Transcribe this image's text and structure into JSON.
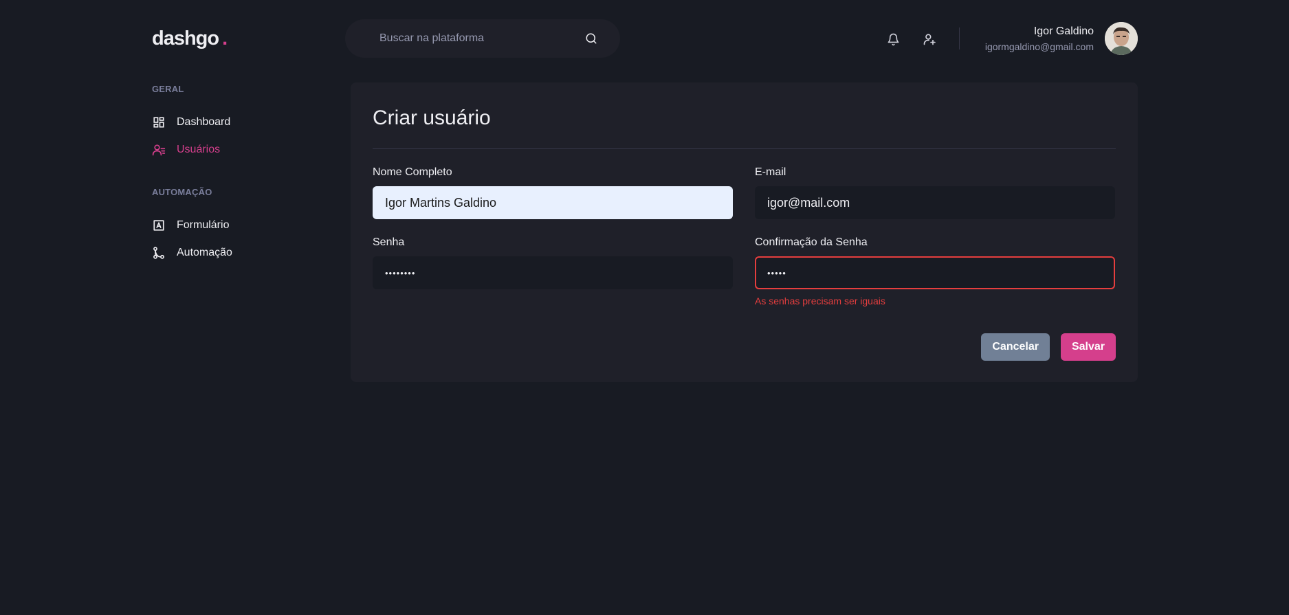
{
  "header": {
    "logo": "dashgo",
    "logo_dot": ".",
    "search_placeholder": "Buscar na plataforma",
    "user_name": "Igor Galdino",
    "user_email": "igormgaldino@gmail.com"
  },
  "sidebar": {
    "sections": [
      {
        "title": "GERAL",
        "items": [
          {
            "label": "Dashboard",
            "icon": "dashboard-icon",
            "active": false
          },
          {
            "label": "Usuários",
            "icon": "users-icon",
            "active": true
          }
        ]
      },
      {
        "title": "AUTOMAÇÃO",
        "items": [
          {
            "label": "Formulário",
            "icon": "form-icon",
            "active": false
          },
          {
            "label": "Automação",
            "icon": "git-merge-icon",
            "active": false
          }
        ]
      }
    ]
  },
  "form": {
    "title": "Criar usuário",
    "fields": {
      "name": {
        "label": "Nome Completo",
        "value": "Igor Martins Galdino"
      },
      "email": {
        "label": "E-mail",
        "value": "igor@mail.com"
      },
      "password": {
        "label": "Senha",
        "value": "••••••••"
      },
      "password_confirmation": {
        "label": "Confirmação da Senha",
        "value": "•••••",
        "error": "As senhas precisam ser iguais"
      }
    },
    "cancel_label": "Cancelar",
    "save_label": "Salvar"
  },
  "colors": {
    "background": "#181b23",
    "surface": "#1f2029",
    "accent": "#d53f8c",
    "error": "#e53e3e",
    "cancel": "#718096",
    "muted": "#9699b0"
  }
}
